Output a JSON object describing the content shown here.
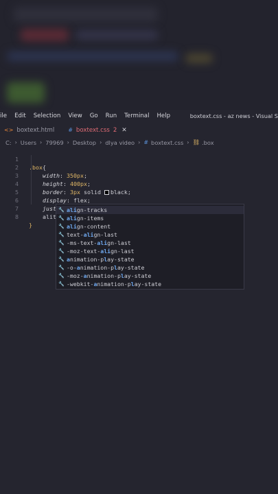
{
  "menu": {
    "items": [
      "ile",
      "Edit",
      "Selection",
      "View",
      "Go",
      "Run",
      "Terminal",
      "Help"
    ],
    "window_title": "boxtext.css - az news - Visual S"
  },
  "tabs": [
    {
      "icon": "<>",
      "label": "boxtext.html"
    },
    {
      "icon": "#",
      "label": "boxtext.css",
      "badge": "2",
      "close": "✕"
    }
  ],
  "breadcrumb": {
    "parts": [
      "C:",
      "Users",
      "79969",
      "Desktop",
      "dlya video"
    ],
    "file": "boxtext.css",
    "symbol": ".box"
  },
  "editor": {
    "line_numbers": [
      "1",
      "2",
      "3",
      "4",
      "5",
      "6",
      "7",
      "8"
    ],
    "typed": "alit"
  },
  "autocomplete": {
    "items": [
      {
        "pre": "",
        "hl": "al",
        "mid": "",
        "hl2": "i",
        "post": "gn-tracks"
      },
      {
        "pre": "",
        "hl": "al",
        "mid": "",
        "hl2": "i",
        "post": "gn-items"
      },
      {
        "pre": "",
        "hl": "al",
        "mid": "",
        "hl2": "i",
        "post": "gn-content"
      },
      {
        "pre": "text-",
        "hl": "ali",
        "mid": "",
        "hl2": "",
        "post": "gn-last"
      },
      {
        "pre": "-ms-text-",
        "hl": "ali",
        "mid": "",
        "hl2": "",
        "post": "gn-last"
      },
      {
        "pre": "-moz-text-",
        "hl": "ali",
        "mid": "",
        "hl2": "",
        "post": "gn-last"
      },
      {
        "pre": "",
        "hl": "a",
        "mid": "nimation-p",
        "hl2": "l",
        "post": "ay-state"
      },
      {
        "pre": "-o-",
        "hl": "a",
        "mid": "nimation-p",
        "hl2": "l",
        "post": "ay-state"
      },
      {
        "pre": "-moz-",
        "hl": "a",
        "mid": "nimation-p",
        "hl2": "l",
        "post": "ay-state"
      },
      {
        "pre": "-webkit-",
        "hl": "a",
        "mid": "nimation-p",
        "hl2": "l",
        "post": "ay-state"
      }
    ]
  },
  "colors": {
    "background": "#25252f",
    "accent_red": "#e06c75",
    "selector": "#e0b766",
    "match": "#6fa8ee"
  }
}
